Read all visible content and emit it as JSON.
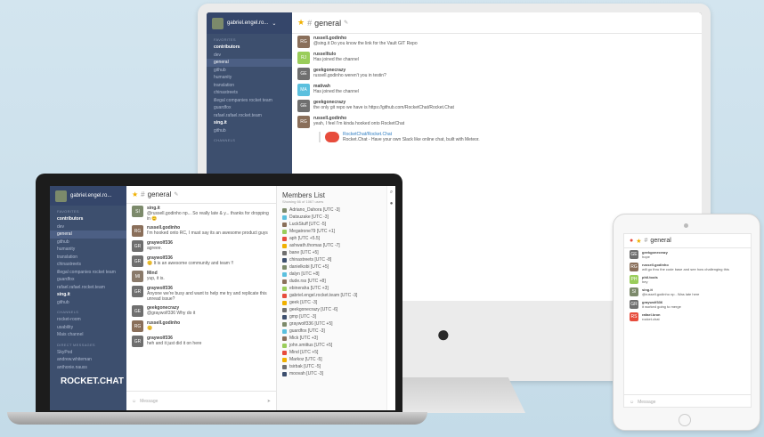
{
  "colors": {
    "sidebar": "#3d4f6e",
    "accent": "#e74c3c",
    "star": "#f0b000",
    "link": "#2d7cc1"
  },
  "imac": {
    "user": "gabriel.engel.ro...",
    "room": "general",
    "favorites_label": "FAVORITES",
    "sidebar_items": [
      "contributors",
      "dev",
      "general",
      "github",
      "humanity",
      "translation",
      "chinastreets",
      "illegal companies rocket team",
      "guardfox",
      "rafael.rafael.rocket.team",
      "sing.it",
      "github"
    ],
    "channels_label": "CHANNELS",
    "messages": [
      {
        "initials": "RG",
        "color": "#8a6f5a",
        "user": "russell.godinho",
        "text": "@sing.it Do you know the link for the Vault GIT Repo"
      },
      {
        "initials": "RJ",
        "color": "#9acd5a",
        "user": "russelltulo",
        "text": "Has joined the channel"
      },
      {
        "initials": "GE",
        "color": "#6f6f6f",
        "user": "geekgonecrazy",
        "text": "russell.godinho weren't you in testin?"
      },
      {
        "initials": "MA",
        "color": "#5bc0de",
        "user": "mativah",
        "text": "Has joined the channel"
      },
      {
        "initials": "GE",
        "color": "#6f6f6f",
        "user": "geekgonecrazy",
        "text": "the only git repo we have is https://github.com/RocketChat/Rocket.Chat"
      },
      {
        "initials": "RG",
        "color": "#8a6f5a",
        "user": "russell.godinho",
        "text": "yeah, I feel I'm kinda hooked onto RocketChat"
      }
    ],
    "embed_title": "RocketChat/Rocket.Chat",
    "embed_desc": "Rocket.Chat - Have your own Slack like online chat, built with Meteor."
  },
  "laptop": {
    "user": "gabriel.engel.ro...",
    "room": "general",
    "favorites_label": "FAVORITES",
    "sidebar_items": [
      "contributors",
      "dev",
      "general",
      "github",
      "humanity",
      "translation",
      "chinastreets",
      "illegal companies rocket team",
      "guardfox",
      "rafael.rafael.rocket.team",
      "sing.it",
      "github"
    ],
    "channels_label": "CHANNELS",
    "channels": [
      "rocket-room",
      "usability",
      "Mais channel"
    ],
    "dm_label": "DIRECT MESSAGES",
    "dms": [
      "SkyPod",
      "andrew.whiteman",
      "anthonie.nauss"
    ],
    "logo": "ROCKET.CHAT",
    "messages": [
      {
        "initials": "SI",
        "color": "#7c8a6b",
        "user": "sing.it",
        "text": "@russell.godinho np... So really late & y... thanks for dropping in 😊"
      },
      {
        "initials": "RG",
        "color": "#8a6f5a",
        "user": "russell.godinho",
        "text": "I'm hooked onto RC, I must say its an awesome product guys"
      },
      {
        "initials": "GR",
        "color": "#6f6f6f",
        "user": "graywolf336",
        "text": "agreee."
      },
      {
        "initials": "GR",
        "color": "#6f6f6f",
        "user": "graywolf336",
        "text": "😊 It is an awesome community and team !!"
      },
      {
        "initials": "MI",
        "color": "#8a7a6a",
        "user": "Mind",
        "text": "yup, it is."
      },
      {
        "initials": "GR",
        "color": "#6f6f6f",
        "user": "graywolf336",
        "text": "Anyone we're busy and want to help me try and replicate this unread issue?"
      },
      {
        "initials": "GE",
        "color": "#6f6f6f",
        "user": "geekgonecrazy",
        "text": "@graywolf336 Why do it"
      },
      {
        "initials": "RG",
        "color": "#8a6f5a",
        "user": "russell.godinho",
        "text": "😊"
      },
      {
        "initials": "GR",
        "color": "#6f6f6f",
        "user": "graywolf336",
        "text": "heh and it just did it on here"
      }
    ],
    "members_title": "Members List",
    "members_sub": "Showing 66 of 1067 users",
    "members": [
      "Adriano_Dahora [UTC -3]",
      "Datsuzake [UTC -3]",
      "LuckStuff [UTC -5]",
      "Megatrone79 [UTC +1]",
      "aph [UTC +5.5]",
      "ashwath.thomas [UTC -7]",
      "bane [UTC +5]",
      "chinastreets [UTC -8]",
      "danielkobi [UTC +5]",
      "dalyn [UTC +8]",
      "dude.rss [UTC +8]",
      "ebineraha [UTC +3]",
      "gabriel.engel.rocket.team [UTC -3]",
      "geek [UTC -3]",
      "geekgonecrazy [UTC -6]",
      "gmp [UTC -3]",
      "graywolf336 [UTC +5]",
      "guardfox [UTC -3]",
      "Mick [UTC +3]",
      "john.smittus [UTC +5]",
      "Mind [UTC +5]",
      "Markoz [UTC -5]",
      "tsirbak [UTC -5]",
      "moovah [UTC -3]"
    ],
    "composer_placeholder": "Message",
    "sidebar_footer": "© 2015 Rocket.Chat"
  },
  "ipad": {
    "room": "general",
    "messages": [
      {
        "initials": "GE",
        "color": "#6f6f6f",
        "user": "geekgonecrazy",
        "text": "hope"
      },
      {
        "initials": "RG",
        "color": "#8a6f5a",
        "user": "russell.godinho",
        "text": "will go thru the code base and see how challenging this"
      },
      {
        "initials": "PH",
        "color": "#9acd5a",
        "user": "phil.tools",
        "text": "hey"
      },
      {
        "initials": "SI",
        "color": "#7c8a6b",
        "user": "sing.it",
        "text": "@russell.godinho np.. Was late here"
      },
      {
        "initials": "GR",
        "color": "#6f6f6f",
        "user": "graywolf336",
        "text": "it worked going to merge"
      },
      {
        "initials": "RS",
        "color": "#e74c3c",
        "user": "rafael.kron",
        "text": "rocket.chat"
      }
    ],
    "composer_placeholder": "Message"
  }
}
